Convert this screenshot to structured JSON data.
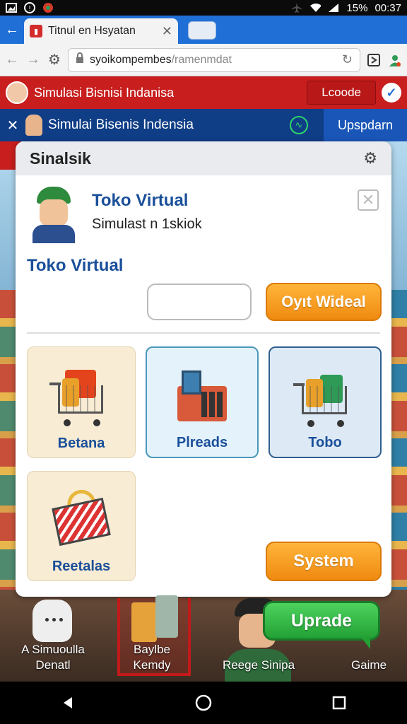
{
  "status_bar": {
    "battery": "15%",
    "time": "00:37",
    "icons": [
      "image-icon",
      "info-icon",
      "app-icon",
      "airplane-icon",
      "wifi-icon",
      "signal-icon"
    ]
  },
  "browser": {
    "tab_title": "Titnul en Hsyatan",
    "url_host": "syoikompembes",
    "url_path": "/ramenmdat"
  },
  "site_header": {
    "title": "Simulasi Bisnisi Indanisa",
    "login_label": "Lcoode"
  },
  "sub_header": {
    "title": "Simulai Bisenis Indensia",
    "upgrade_label": "Upspdarn"
  },
  "dialog": {
    "title": "Sinalsik",
    "profile_name": "Toko Virtual",
    "profile_subtitle": "Simulast n 1skiok",
    "section_title": "Toko Virtual",
    "input_value": "",
    "input_placeholder": "",
    "action_button": "Oyıt Wideal",
    "categories": [
      {
        "label": "Betana"
      },
      {
        "label": "Plreads"
      },
      {
        "label": "Tobo"
      },
      {
        "label": "Reetalas"
      }
    ],
    "system_button": "System"
  },
  "game_hud": {
    "item1_line1": "A Simuoulla",
    "item1_line2": "Denatl",
    "item2_line1": "Baylbe",
    "item2_line2": "Kemdy",
    "item3": "Reege Sinipa",
    "upgrade_button": "Uprade",
    "item4": "Gaime"
  },
  "colors": {
    "browser_blue": "#1f6fd6",
    "site_red": "#c81e1e",
    "sub_header_blue": "#0f3d86",
    "title_blue": "#1a4f9a",
    "orange_button": "#f08a10",
    "green_button": "#22a034"
  }
}
